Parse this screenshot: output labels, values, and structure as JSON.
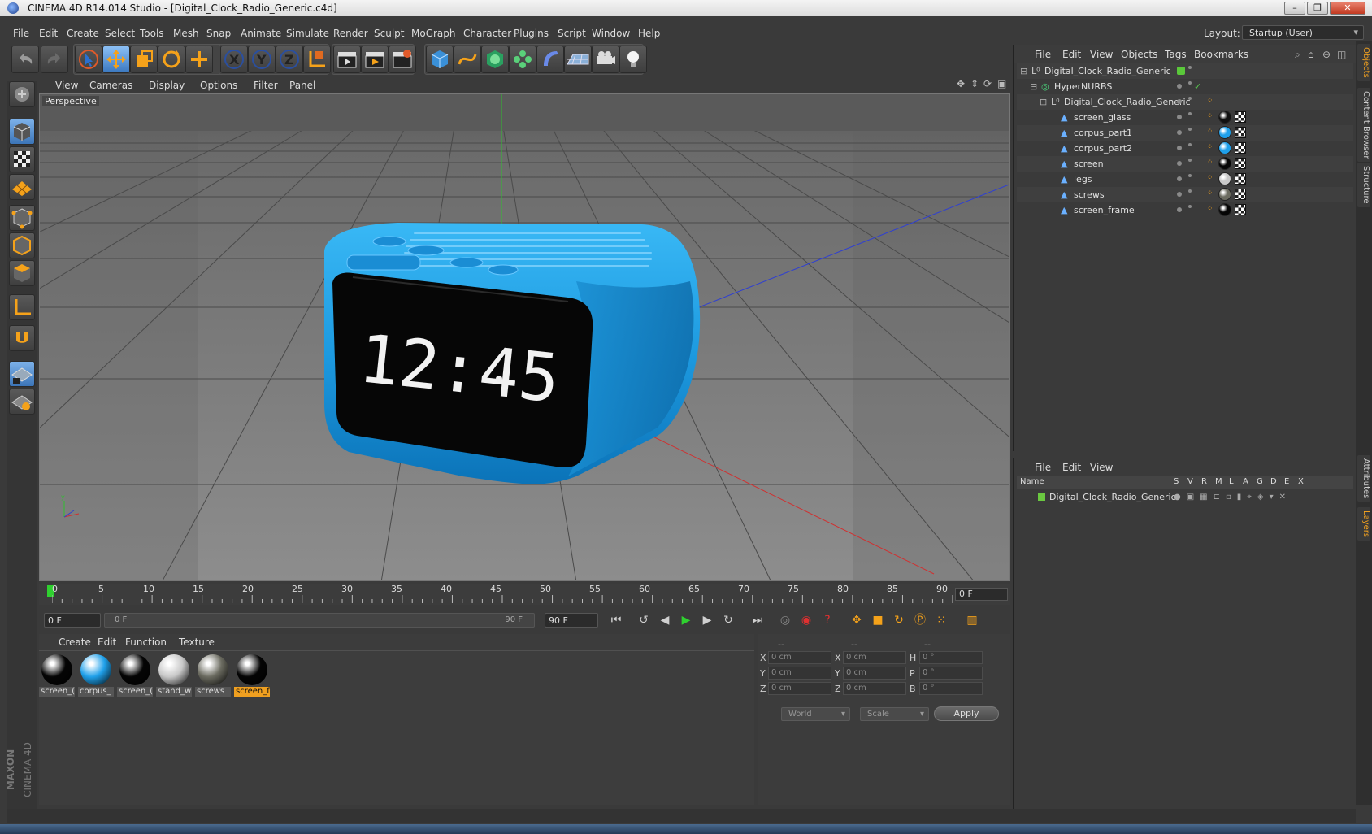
{
  "window": {
    "title": "CINEMA 4D R14.014 Studio - [Digital_Clock_Radio_Generic.c4d]",
    "minimize": "–",
    "maximize": "❐",
    "close": "✕"
  },
  "menubar": {
    "items": [
      "File",
      "Edit",
      "Create",
      "Select",
      "Tools",
      "Mesh",
      "Snap",
      "Animate",
      "Simulate",
      "Render",
      "Sculpt",
      "MoGraph",
      "Character",
      "Plugins",
      "Script",
      "Window",
      "Help"
    ],
    "layout_label": "Layout:",
    "layout_value": "Startup (User)"
  },
  "viewport": {
    "menu": [
      "View",
      "Cameras",
      "Display",
      "Options",
      "Filter",
      "Panel"
    ],
    "label": "Perspective",
    "clock_display": "12:45"
  },
  "timeline": {
    "ticks": [
      "0",
      "5",
      "10",
      "15",
      "20",
      "25",
      "30",
      "35",
      "40",
      "45",
      "50",
      "55",
      "60",
      "65",
      "70",
      "75",
      "80",
      "85",
      "90"
    ],
    "current_frame": "0 F",
    "start_field": "0 F",
    "range_start": "0 F",
    "range_end": "90 F",
    "end_field": "90 F"
  },
  "materials": {
    "menu": [
      "Create",
      "Edit",
      "Function",
      "Texture"
    ],
    "items": [
      {
        "label": "screen_(",
        "color": "#050505"
      },
      {
        "label": "corpus_",
        "color": "#1fa0ea"
      },
      {
        "label": "screen_(",
        "color": "#050505"
      },
      {
        "label": "stand_w",
        "color": "#c8c8c8"
      },
      {
        "label": "screws",
        "color": "#6b6b60"
      },
      {
        "label": "screen_f",
        "color": "#050505",
        "selected": true
      }
    ]
  },
  "coordinates": {
    "headers": [
      "--",
      "--",
      "--"
    ],
    "rows": [
      {
        "a": "X",
        "av": "0 cm",
        "b": "X",
        "bv": "0 cm",
        "c": "H",
        "cv": "0 °"
      },
      {
        "a": "Y",
        "av": "0 cm",
        "b": "Y",
        "bv": "0 cm",
        "c": "P",
        "cv": "0 °"
      },
      {
        "a": "Z",
        "av": "0 cm",
        "b": "Z",
        "bv": "0 cm",
        "c": "B",
        "cv": "0 °"
      }
    ],
    "mode1": "World",
    "mode2": "Scale",
    "apply": "Apply"
  },
  "objects": {
    "menu": [
      "File",
      "Edit",
      "View",
      "Objects",
      "Tags",
      "Bookmarks"
    ],
    "rows": [
      {
        "name": "Digital_Clock_Radio_Generic",
        "indent": 0,
        "kind": "null"
      },
      {
        "name": "HyperNURBS",
        "indent": 1,
        "kind": "nurbs"
      },
      {
        "name": "Digital_Clock_Radio_Generic",
        "indent": 2,
        "kind": "null"
      },
      {
        "name": "screen_glass",
        "indent": 3,
        "kind": "poly",
        "tag": "#111111"
      },
      {
        "name": "corpus_part1",
        "indent": 3,
        "kind": "poly",
        "tag": "#1fa0ea"
      },
      {
        "name": "corpus_part2",
        "indent": 3,
        "kind": "poly",
        "tag": "#1fa0ea"
      },
      {
        "name": "screen",
        "indent": 3,
        "kind": "poly",
        "tag": "#050505"
      },
      {
        "name": "legs",
        "indent": 3,
        "kind": "poly",
        "tag": "#c8c8c8"
      },
      {
        "name": "screws",
        "indent": 3,
        "kind": "poly",
        "tag": "#6b6b60"
      },
      {
        "name": "screen_frame",
        "indent": 3,
        "kind": "poly",
        "tag": "#050505"
      }
    ]
  },
  "layers": {
    "menu": [
      "File",
      "Edit",
      "View"
    ],
    "columns": [
      "Name",
      "S",
      "V",
      "R",
      "M",
      "L",
      "A",
      "G",
      "D",
      "E",
      "X"
    ],
    "rows": [
      {
        "name": "Digital_Clock_Radio_Generic"
      }
    ]
  },
  "right_tabs": [
    "Objects",
    "Content Browser",
    "Structure",
    "Attributes",
    "Layers"
  ],
  "watermark": {
    "brand": "MAXON",
    "product": "CINEMA 4D"
  }
}
